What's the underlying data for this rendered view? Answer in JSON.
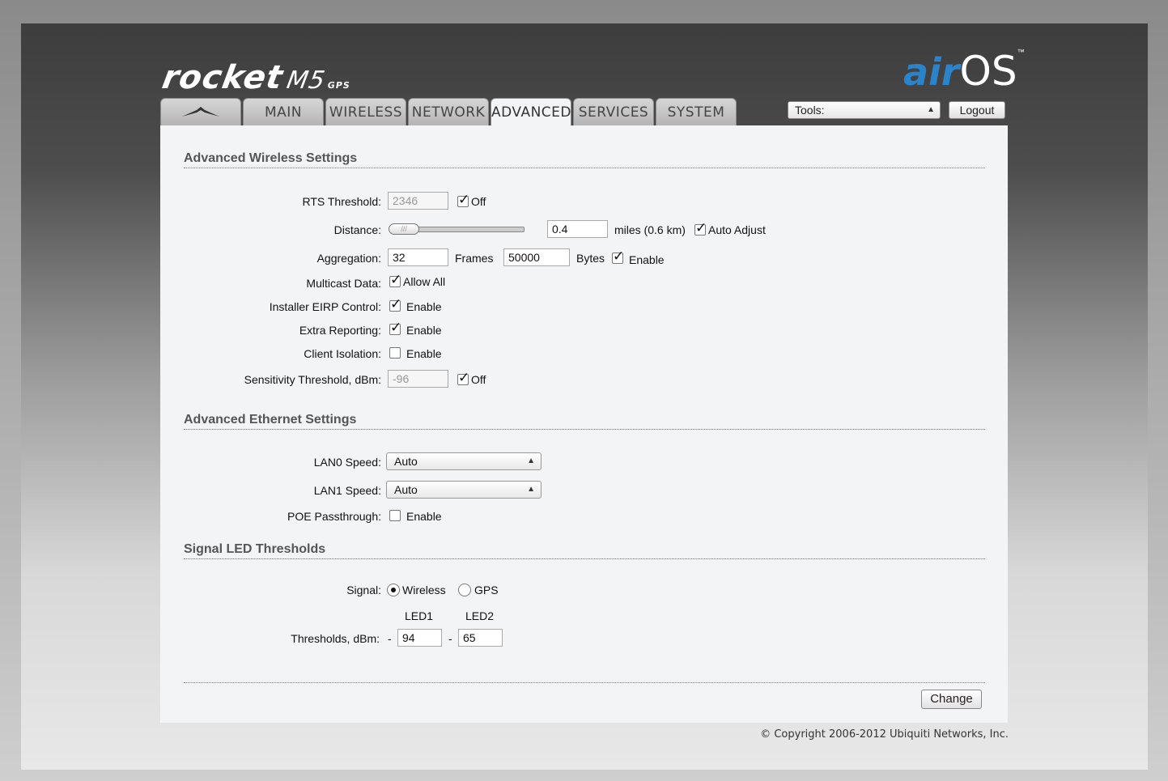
{
  "brand": {
    "product": "rocket",
    "model": "M5",
    "variant": "GPS",
    "os_prefix": "air",
    "os_suffix": "OS",
    "trademark": "™",
    "accent_color": "#2b83c9"
  },
  "tabs": [
    {
      "label": "",
      "icon": "ubiquiti-logo-icon"
    },
    {
      "label": "MAIN"
    },
    {
      "label": "WIRELESS"
    },
    {
      "label": "NETWORK"
    },
    {
      "label": "ADVANCED",
      "active": true
    },
    {
      "label": "SERVICES"
    },
    {
      "label": "SYSTEM"
    }
  ],
  "toolbar": {
    "tools_value": "Tools:",
    "logout_label": "Logout"
  },
  "wireless": {
    "title": "Advanced Wireless Settings",
    "rts_label": "RTS Threshold:",
    "rts_value": "2346",
    "rts_off_label": "Off",
    "rts_off_checked": true,
    "distance_label": "Distance:",
    "distance_value": "0.4",
    "distance_unit": "miles (0.6 km)",
    "auto_adjust_label": "Auto Adjust",
    "auto_adjust_checked": true,
    "aggregation_label": "Aggregation:",
    "aggregation_frames": "32",
    "frames_label": "Frames",
    "aggregation_bytes": "50000",
    "bytes_label": "Bytes",
    "aggregation_enable_label": "Enable",
    "multicast_label": "Multicast Data:",
    "multicast_value_label": "Allow All",
    "eirp_label": "Installer EIRP Control:",
    "eirp_enable_label": "Enable",
    "extra_label": "Extra Reporting:",
    "extra_enable_label": "Enable",
    "isolation_label": "Client Isolation:",
    "isolation_enable_label": "Enable",
    "sensitivity_label": "Sensitivity Threshold, dBm:",
    "sensitivity_value": "-96",
    "sensitivity_off_label": "Off"
  },
  "ethernet": {
    "title": "Advanced Ethernet Settings",
    "lan0_label": "LAN0 Speed:",
    "lan0_value": "Auto",
    "lan1_label": "LAN1 Speed:",
    "lan1_value": "Auto",
    "poe_label": "POE Passthrough:",
    "poe_enable_label": "Enable"
  },
  "led": {
    "title": "Signal LED Thresholds",
    "signal_label": "Signal:",
    "option_wireless": "Wireless",
    "option_gps": "GPS",
    "selected": "Wireless",
    "led1_header": "LED1",
    "led2_header": "LED2",
    "thresholds_label": "Thresholds, dBm:",
    "dash": "-",
    "led1_value": "94",
    "led2_value": "65"
  },
  "actions": {
    "change_label": "Change"
  },
  "footer": {
    "copyright": "© Copyright 2006-2012 Ubiquiti Networks, Inc."
  }
}
